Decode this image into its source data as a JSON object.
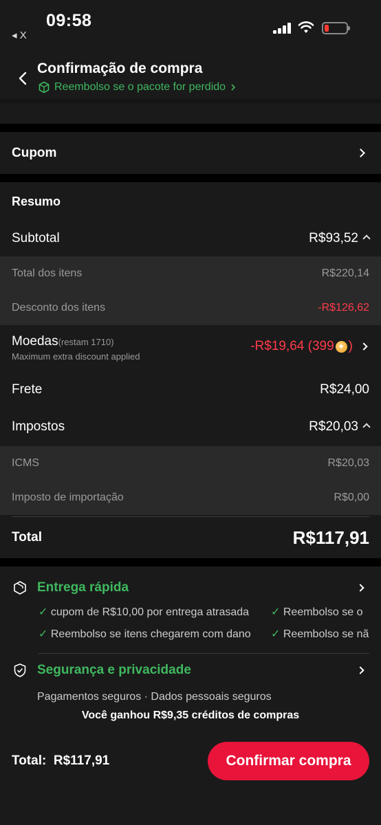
{
  "status": {
    "time": "09:58",
    "back_app": "◂ X"
  },
  "header": {
    "title": "Confirmação de compra",
    "refund": "Reembolso se o pacote for perdido"
  },
  "coupon": {
    "label": "Cupom"
  },
  "summary": {
    "title": "Resumo",
    "subtotal_label": "Subtotal",
    "subtotal_value": "R$93,52",
    "items_total_label": "Total dos itens",
    "items_total_value": "R$220,14",
    "items_discount_label": "Desconto dos itens",
    "items_discount_value": "-R$126,62",
    "coins_label": "Moedas",
    "coins_remaining": "(restam 1710)",
    "coins_note": "Maximum extra discount applied",
    "coins_value": "-R$19,64 (399",
    "coins_value_end": ")",
    "shipping_label": "Frete",
    "shipping_value": "R$24,00",
    "taxes_label": "Impostos",
    "taxes_value": "R$20,03",
    "icms_label": "ICMS",
    "icms_value": "R$20,03",
    "import_label": "Imposto de importação",
    "import_value": "R$0,00",
    "total_label": "Total",
    "total_value": "R$117,91"
  },
  "delivery": {
    "title": "Entrega rápida",
    "f1": "cupom de R$10,00 por entrega atrasada",
    "f2": "Reembolso se o",
    "f3": "Reembolso se itens chegarem com dano",
    "f4": "Reembolso se nã"
  },
  "security": {
    "title": "Segurança e privacidade",
    "desc": "Pagamentos seguros · Dados pessoais seguros"
  },
  "credits": "Você ganhou R$9,35 créditos de compras",
  "footer": {
    "total_label": "Total:",
    "total_value": "R$117,91",
    "confirm": "Confirmar compra"
  },
  "colors": {
    "accent": "#e8143a",
    "green": "#3fb85f",
    "discount": "#ff3a4a"
  }
}
